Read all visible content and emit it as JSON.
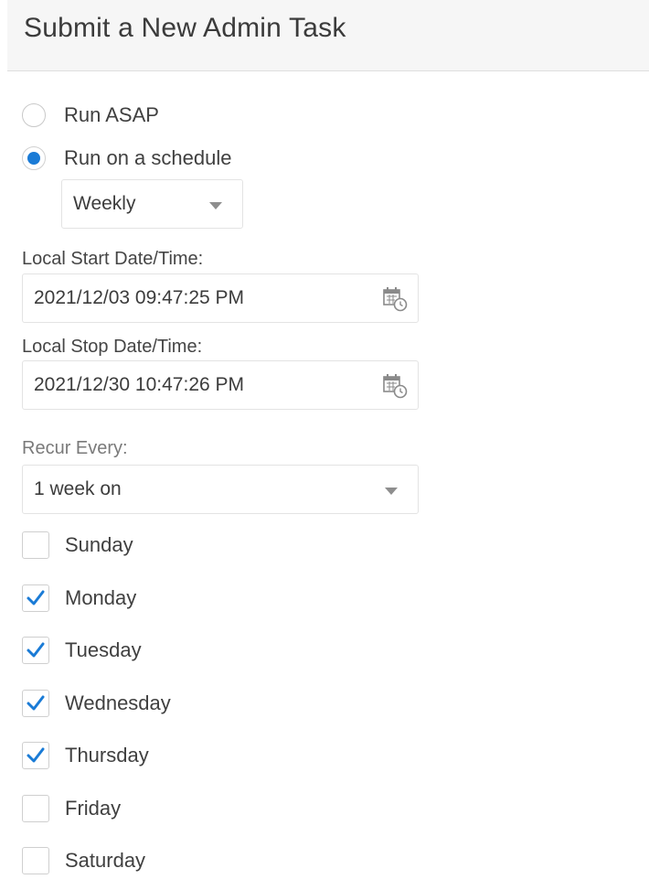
{
  "header": {
    "title": "Submit a New Admin Task"
  },
  "run_options": [
    {
      "label": "Run ASAP",
      "selected": false
    },
    {
      "label": "Run on a schedule",
      "selected": true
    }
  ],
  "schedule": {
    "frequency": "Weekly"
  },
  "start": {
    "label": "Local Start Date/Time:",
    "value": "2021/12/03 09:47:25 PM",
    "icon": "calendar-clock-icon"
  },
  "stop": {
    "label": "Local Stop Date/Time:",
    "value": "2021/12/30 10:47:26 PM",
    "icon": "calendar-clock-icon"
  },
  "recur": {
    "label": "Recur Every:",
    "value": "1 week on"
  },
  "days": [
    {
      "label": "Sunday",
      "checked": false
    },
    {
      "label": "Monday",
      "checked": true
    },
    {
      "label": "Tuesday",
      "checked": true
    },
    {
      "label": "Wednesday",
      "checked": true
    },
    {
      "label": "Thursday",
      "checked": true
    },
    {
      "label": "Friday",
      "checked": false
    },
    {
      "label": "Saturday",
      "checked": false
    }
  ],
  "colors": {
    "accent": "#1a7bd6"
  }
}
